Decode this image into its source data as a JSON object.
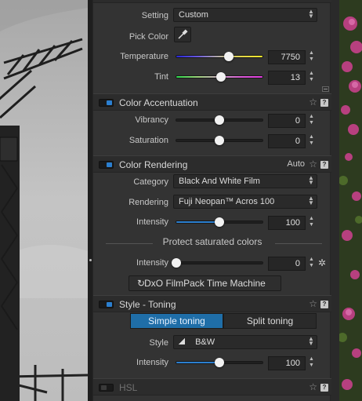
{
  "colors": {
    "panel_bg": "#333333",
    "accent_blue": "#2b7fd0",
    "segment_active": "#1f6ea8"
  },
  "white_balance": {
    "setting": {
      "label": "Setting",
      "value": "Custom"
    },
    "pick_color": {
      "label": "Pick Color",
      "icon": "eyedropper-icon"
    },
    "temperature": {
      "label": "Temperature",
      "value": "7750",
      "position": 0.61
    },
    "tint": {
      "label": "Tint",
      "value": "13",
      "position": 0.52
    }
  },
  "color_accentuation": {
    "title": "Color Accentuation",
    "vibrancy": {
      "label": "Vibrancy",
      "value": "0",
      "position": 0.5
    },
    "saturation": {
      "label": "Saturation",
      "value": "0",
      "position": 0.5
    }
  },
  "color_rendering": {
    "title": "Color Rendering",
    "mode": "Auto",
    "category": {
      "label": "Category",
      "value": "Black And White Film"
    },
    "rendering": {
      "label": "Rendering",
      "value": "Fuji Neopan™ Acros 100"
    },
    "intensity": {
      "label": "Intensity",
      "value": "100",
      "position": 0.5
    },
    "protect_label": "Protect saturated colors",
    "protect_intensity": {
      "label": "Intensity",
      "value": "0",
      "position": 0.0
    },
    "time_machine_button": "DxO FilmPack Time Machine"
  },
  "style_toning": {
    "title": "Style - Toning",
    "tab_simple": "Simple toning",
    "tab_split": "Split toning",
    "style": {
      "label": "Style",
      "value": "B&W"
    },
    "intensity": {
      "label": "Intensity",
      "value": "100",
      "position": 0.5
    }
  },
  "hsl": {
    "title": "HSL"
  },
  "icons": {
    "star": "star-icon",
    "help": "help-icon",
    "wand": "magic-wand-icon",
    "undo": "time-machine-icon"
  }
}
